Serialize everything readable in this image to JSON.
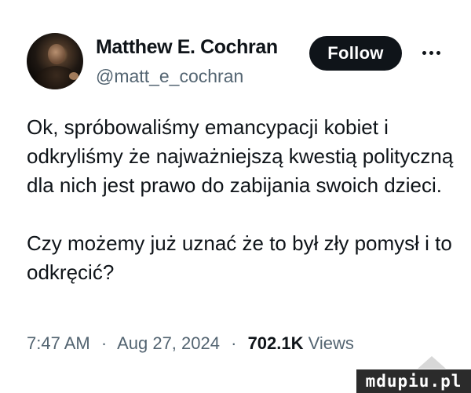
{
  "author": {
    "display_name": "Matthew E. Cochran",
    "handle": "@matt_e_cochran",
    "avatar_icon": "profile-photo"
  },
  "actions": {
    "follow_label": "Follow",
    "more_icon": "more-horizontal-icon"
  },
  "tweet": {
    "paragraphs": [
      "Ok, spróbowaliśmy emancypacji kobiet i odkryliśmy że najważniejszą kwestią polityczną dla nich jest prawo do zabijania swoich dzieci.",
      "Czy możemy już uznać że to był zły pomysł i to odkręcić?"
    ]
  },
  "meta": {
    "time": "7:47 AM",
    "separator": "·",
    "date": "Aug 27, 2024",
    "views_count": "702.1K",
    "views_label": "Views"
  },
  "watermark": {
    "text": "mdupiu.pl"
  },
  "colors": {
    "text_primary": "#0f1419",
    "text_secondary": "#536471",
    "follow_bg": "#0f1419",
    "background": "#ffffff"
  }
}
